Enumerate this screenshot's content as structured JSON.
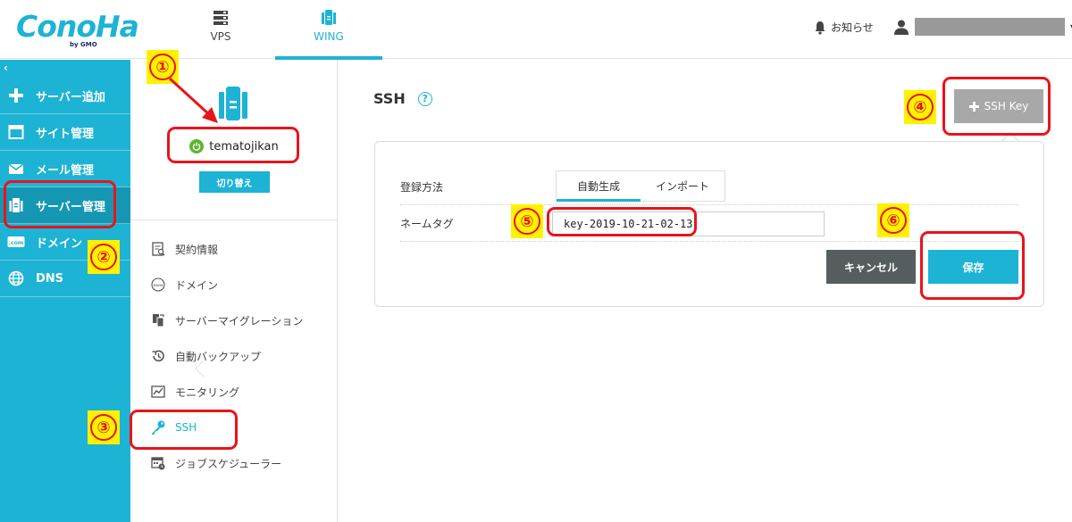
{
  "header": {
    "logo_text": "ConoHa",
    "logo_sub": "by GMO",
    "nav": [
      {
        "label": "VPS",
        "icon": "server-icon"
      },
      {
        "label": "WING",
        "icon": "wing-server-icon",
        "active": true
      }
    ],
    "notice_label": "お知らせ",
    "user_caret": "▾"
  },
  "sidebar": {
    "collapse": "‹",
    "items": [
      {
        "label": "サーバー追加",
        "icon": "plus-icon"
      },
      {
        "label": "サイト管理",
        "icon": "window-icon"
      },
      {
        "label": "メール管理",
        "icon": "mail-icon"
      },
      {
        "label": "サーバー管理",
        "icon": "server-icon",
        "active": true
      },
      {
        "label": "ドメイン",
        "icon": "domain-icon"
      },
      {
        "label": "DNS",
        "icon": "globe-icon"
      }
    ]
  },
  "server": {
    "name": "tematojikan",
    "switch_label": "切り替え"
  },
  "menu": [
    {
      "label": "契約情報",
      "icon": "contract-icon"
    },
    {
      "label": "ドメイン",
      "icon": "www-icon"
    },
    {
      "label": "サーバーマイグレーション",
      "icon": "migration-icon"
    },
    {
      "label": "自動バックアップ",
      "icon": "backup-icon"
    },
    {
      "label": "モニタリング",
      "icon": "monitoring-icon"
    },
    {
      "label": "SSH",
      "icon": "key-icon",
      "active": true
    },
    {
      "label": "ジョブスケジューラー",
      "icon": "scheduler-icon"
    }
  ],
  "main": {
    "title": "SSH",
    "help": "?",
    "sshkey_label": "SSH Key",
    "form": {
      "method_label": "登録方法",
      "tabs": [
        "自動生成",
        "インポート"
      ],
      "nametag_label": "ネームタグ",
      "nametag_value": "key-2019-10-21-02-13",
      "cancel_label": "キャンセル",
      "save_label": "保存"
    }
  },
  "annotations": [
    "①",
    "②",
    "③",
    "④",
    "⑤",
    "⑥"
  ],
  "colors": {
    "accent": "#1db3d4",
    "annotation": "#e8141b",
    "marker": "#fff200"
  }
}
